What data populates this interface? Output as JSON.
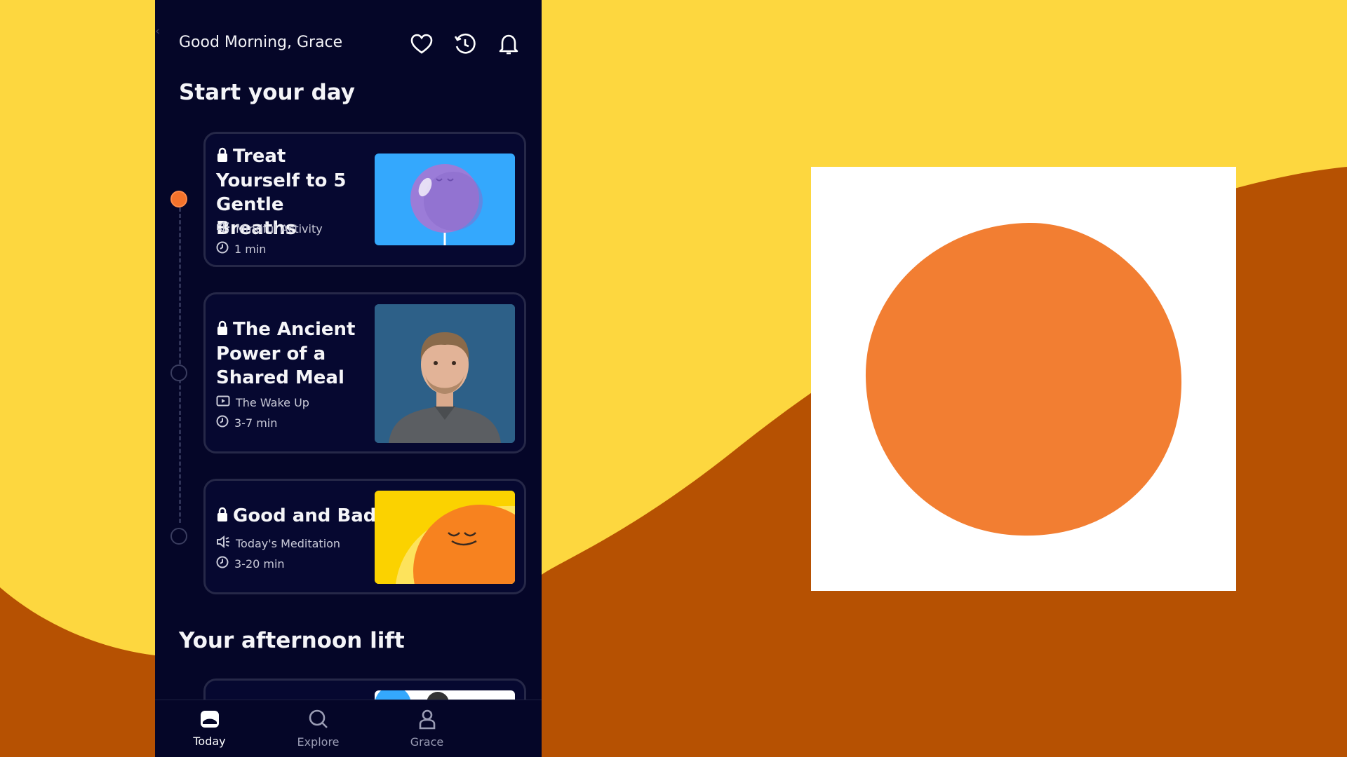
{
  "colors": {
    "background_yellow": "#FDD73F",
    "background_brown": "#B65102",
    "panel_bg": "#050628",
    "accent_orange": "#F4722B",
    "card_border": "#262848"
  },
  "header": {
    "greeting": "Good Morning, Grace",
    "icons": [
      "heart-icon",
      "history-icon",
      "bell-icon"
    ]
  },
  "sections": {
    "start_day": "Start your day",
    "afternoon": "Your afternoon lift"
  },
  "cards": [
    {
      "title": "Treat Yourself to 5 Gentle Breaths",
      "type": "Mindful Activity",
      "type_icon": "audio-icon",
      "duration": "1 min",
      "thumb": "purple-balloon"
    },
    {
      "title": "The Ancient Power of a Shared Meal",
      "type": "The Wake Up",
      "type_icon": "video-icon",
      "duration": "3-7 min",
      "thumb": "man-portrait"
    },
    {
      "title": "Good and Bad",
      "type": "Today's Meditation",
      "type_icon": "audio-icon",
      "duration": "3-20 min",
      "thumb": "smiling-sun"
    }
  ],
  "nav": [
    {
      "label": "Today",
      "icon": "today-icon",
      "active": true
    },
    {
      "label": "Explore",
      "icon": "search-icon",
      "active": false
    },
    {
      "label": "Grace",
      "icon": "profile-icon",
      "active": false
    }
  ]
}
